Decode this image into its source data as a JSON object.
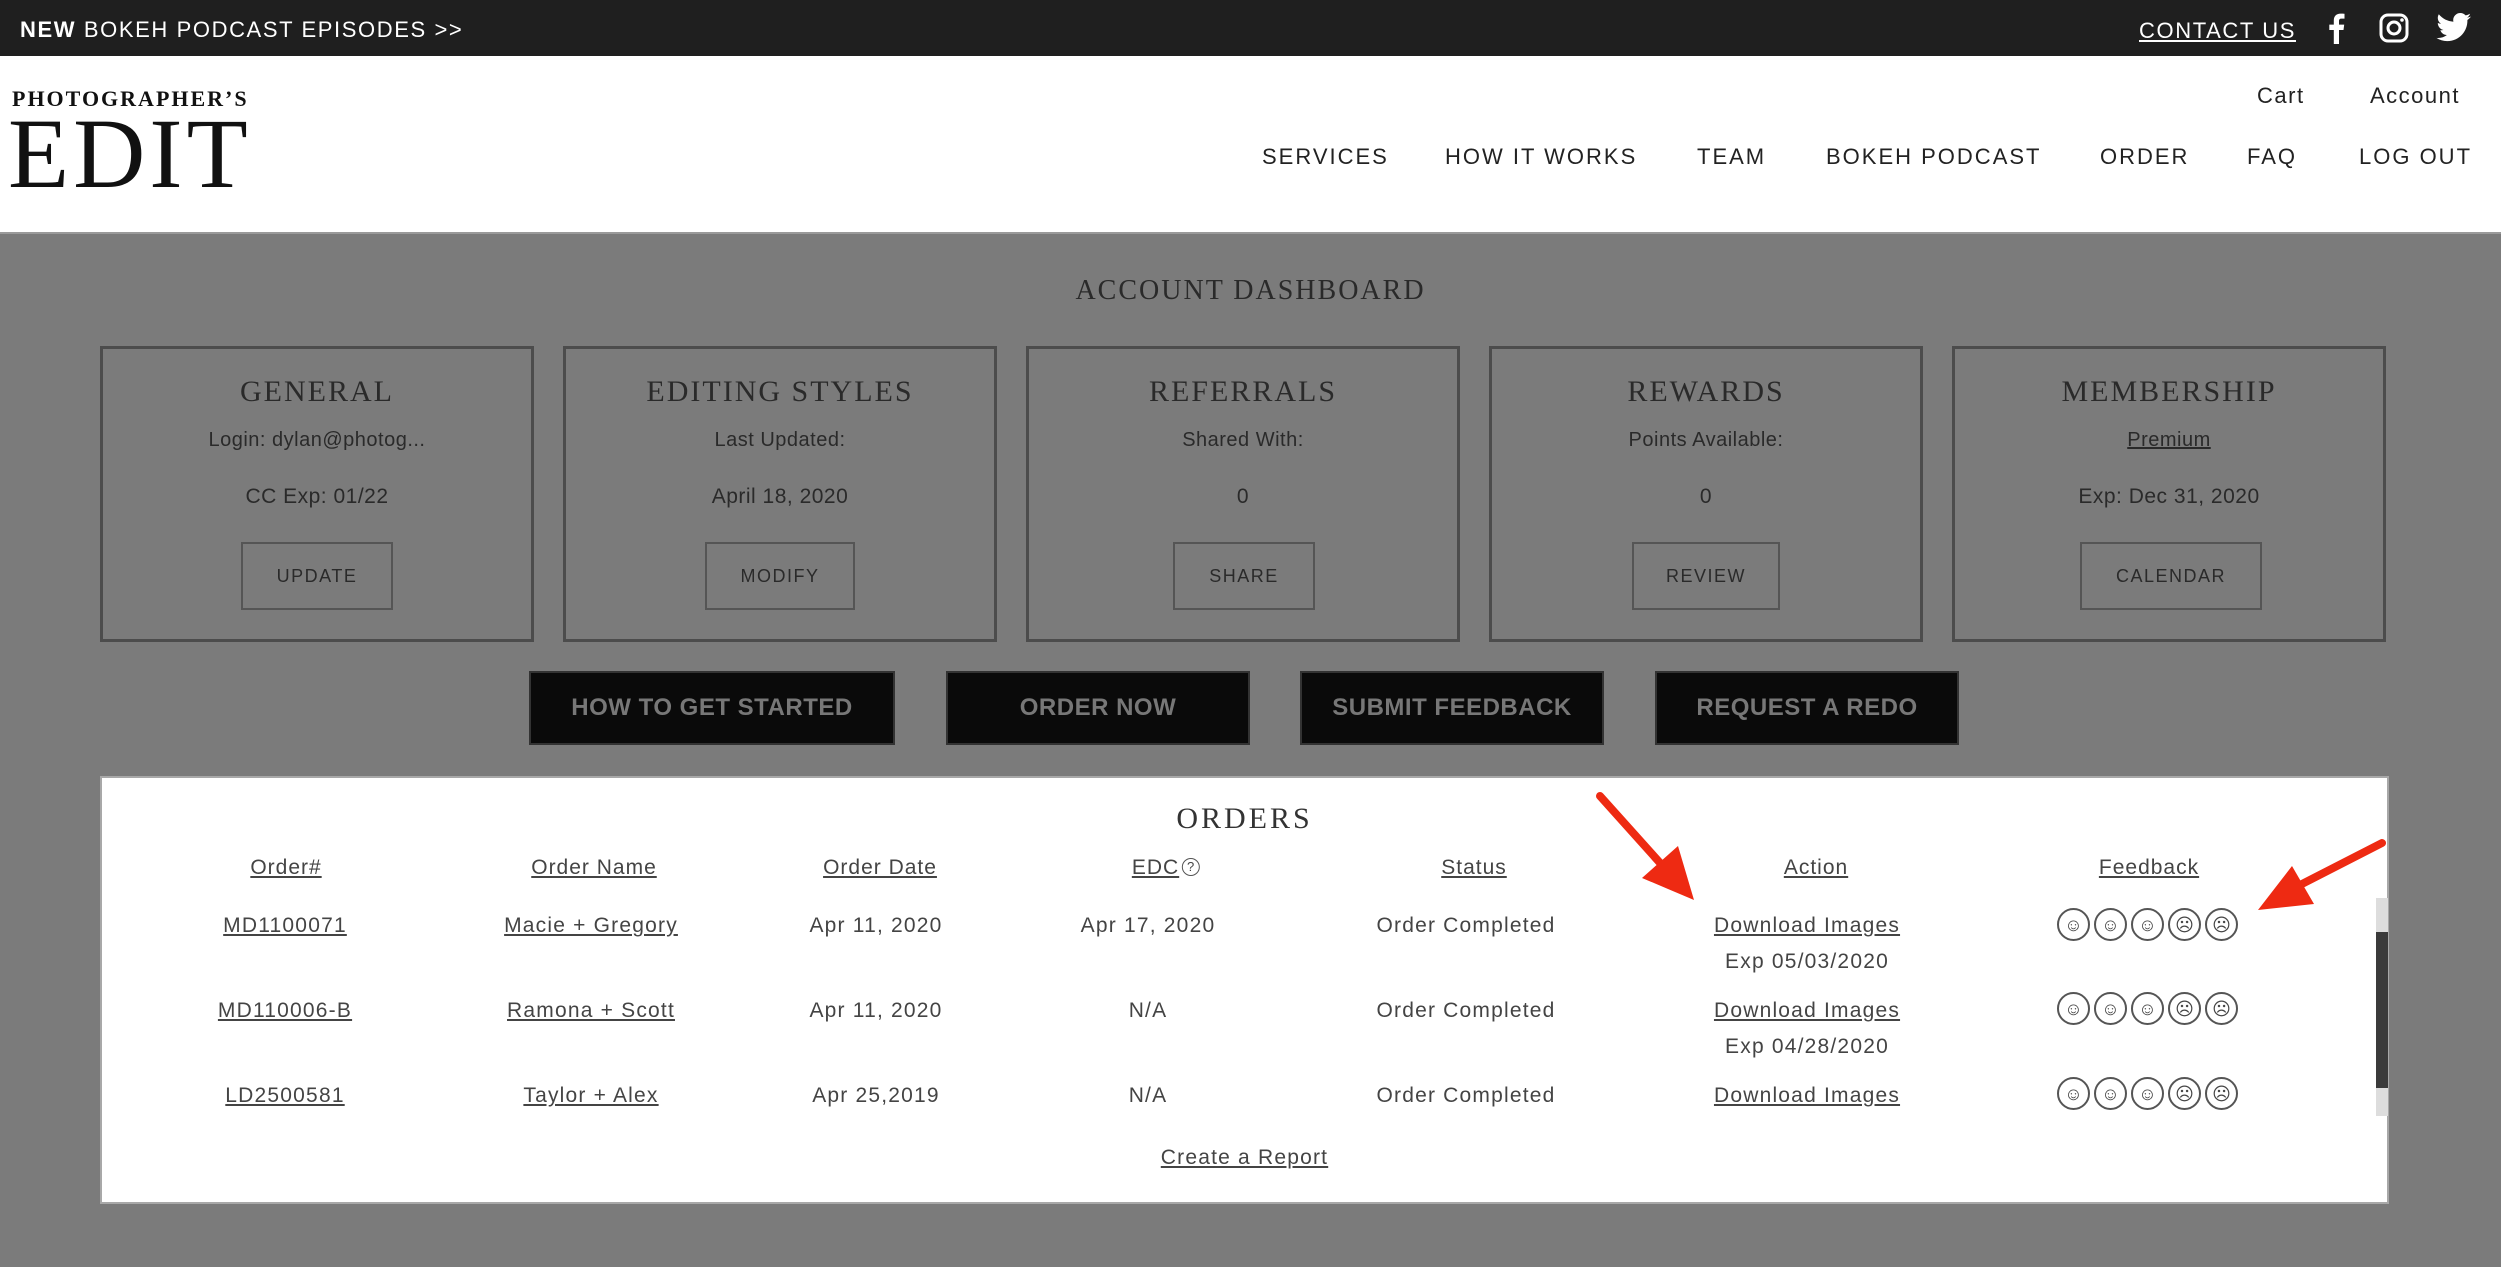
{
  "topbar": {
    "promo_new": "NEW",
    "promo_text": "BOKEH PODCAST EPISODES >>",
    "contact": "CONTACT US",
    "social_icons": [
      "facebook-icon",
      "instagram-icon",
      "twitter-icon"
    ]
  },
  "header": {
    "logo_top": "PHOTOGRAPHER’S",
    "logo_main": "EDIT",
    "cart": "Cart",
    "account": "Account",
    "nav": [
      "SERVICES",
      "HOW IT WORKS",
      "TEAM",
      "BOKEH PODCAST",
      "ORDER",
      "FAQ",
      "LOG OUT"
    ]
  },
  "dashboard": {
    "title": "ACCOUNT DASHBOARD",
    "cards": [
      {
        "title": "GENERAL",
        "line1": "Login: dylan@photog...",
        "line2": "CC Exp: 01/22",
        "button": "UPDATE"
      },
      {
        "title": "EDITING STYLES",
        "line1": "Last Updated:",
        "line2": "April 18, 2020",
        "button": "MODIFY"
      },
      {
        "title": "REFERRALS",
        "line1": "Shared With:",
        "line2": "0",
        "button": "SHARE"
      },
      {
        "title": "REWARDS",
        "line1": "Points Available:",
        "line2": "0",
        "button": "REVIEW"
      },
      {
        "title": "MEMBERSHIP",
        "line1": "Premium",
        "line2": "Exp: Dec 31, 2020",
        "button": "CALENDAR"
      }
    ],
    "actions": [
      "HOW TO GET STARTED",
      "ORDER NOW",
      "SUBMIT FEEDBACK",
      "REQUEST A REDO"
    ]
  },
  "orders": {
    "title": "ORDERS",
    "columns": [
      "Order#",
      "Order Name",
      "Order Date",
      "EDC",
      "Status",
      "Action",
      "Feedback"
    ],
    "rows": [
      {
        "order_no": "MD1100071",
        "name": "Macie + Gregory",
        "date": "Apr 11, 2020",
        "edc": "Apr 17, 2020",
        "status": "Order Completed",
        "action": "Download Images",
        "expiry": "Exp 05/03/2020"
      },
      {
        "order_no": "MD110006-B",
        "name": "Ramona + Scott",
        "date": "Apr 11, 2020",
        "edc": "N/A",
        "status": "Order Completed",
        "action": "Download Images",
        "expiry": "Exp 04/28/2020"
      },
      {
        "order_no": "LD2500581",
        "name": "Taylor + Alex",
        "date": "Apr 25,2019",
        "edc": "N/A",
        "status": "Order Completed",
        "action": "Download Images",
        "expiry": ""
      }
    ],
    "feedback_icons": [
      "very-happy-face-icon",
      "happy-face-icon",
      "neutral-face-icon",
      "sad-face-icon",
      "very-sad-face-icon"
    ],
    "create_report": "Create a Report"
  },
  "colors": {
    "topbar": "#1f1f1f",
    "overlay_gray": "#7b7b7b",
    "annotation_arrow": "#ee2a12"
  }
}
